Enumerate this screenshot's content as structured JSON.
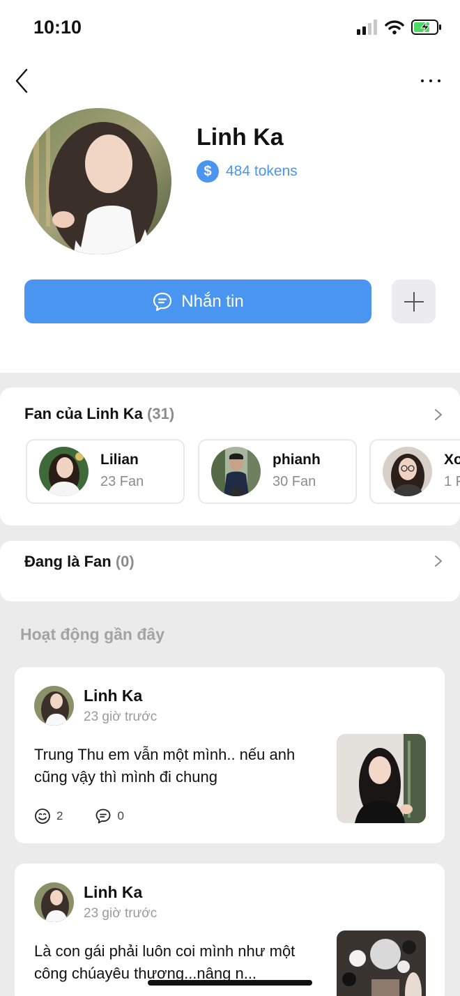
{
  "status_bar": {
    "time": "10:10",
    "icons": [
      "signal-icon",
      "wifi-icon",
      "battery-charging-icon"
    ]
  },
  "nav": {
    "back_icon": "chevron-left-icon",
    "more_icon": "more-horizontal-icon"
  },
  "profile": {
    "name": "Linh Ka",
    "token_symbol": "$",
    "tokens_text": "484 tokens",
    "message_button_label": "Nhắn tin",
    "message_icon": "chat-bubble-icon",
    "add_icon": "plus-icon",
    "accent_color": "#4a95f0"
  },
  "fans_section": {
    "title": "Fan của Linh Ka",
    "count": "(31)",
    "fans": [
      {
        "name": "Lilian",
        "fan_count": "23 Fan"
      },
      {
        "name": "phianh",
        "fan_count": "30 Fan"
      },
      {
        "name": "Xo",
        "fan_count": "1 F"
      }
    ]
  },
  "fan_of_section": {
    "title": "Đang là Fan",
    "count": "(0)"
  },
  "recent_activity": {
    "title": "Hoạt động gần đây",
    "posts": [
      {
        "author": "Linh Ka",
        "time": "23 giờ trước",
        "text": "Trung Thu em vẫn một mình.. nếu anh cũng vậy thì mình đi chung",
        "reactions": "2",
        "comments": "0"
      },
      {
        "author": "Linh Ka",
        "time": "23 giờ trước",
        "text": "Là con gái phải luôn coi mình như một công chúayêu thương...nâng n..."
      }
    ]
  }
}
